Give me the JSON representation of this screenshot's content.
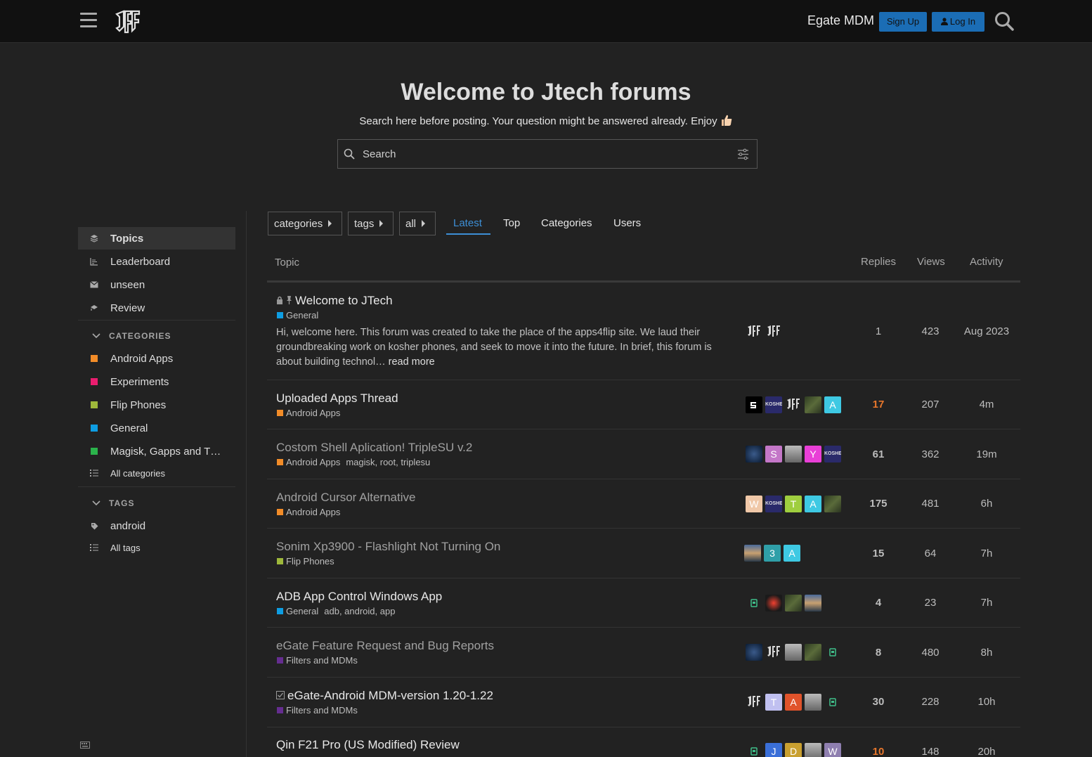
{
  "header": {
    "site_name": "Egate MDM",
    "signup_label": "Sign Up",
    "login_label": "Log In"
  },
  "banner": {
    "title": "Welcome to Jtech forums",
    "subtitle": "Search here before posting. Your question might be answered already. Enjoy",
    "search_placeholder": "Search"
  },
  "sidebar": {
    "items": [
      {
        "label": "Topics",
        "icon": "layers-icon"
      },
      {
        "label": "Leaderboard",
        "icon": "chart-icon"
      },
      {
        "label": "unseen",
        "icon": "envelope-icon"
      },
      {
        "label": "Review",
        "icon": "review-icon"
      }
    ],
    "categories_heading": "CATEGORIES",
    "categories": [
      {
        "label": "Android Apps",
        "color": "#f28c28"
      },
      {
        "label": "Experiments",
        "color": "#ea1d6f"
      },
      {
        "label": "Flip Phones",
        "color": "#9eb83b"
      },
      {
        "label": "General",
        "color": "#0e9de2"
      },
      {
        "label": "Magisk, Gapps and T…",
        "color": "#2bb34b"
      }
    ],
    "all_categories": "All categories",
    "tags_heading": "TAGS",
    "tags": [
      {
        "label": "android"
      }
    ],
    "all_tags": "All tags"
  },
  "nav": {
    "dropdowns": [
      "categories",
      "tags",
      "all"
    ],
    "tabs": [
      "Latest",
      "Top",
      "Categories",
      "Users"
    ]
  },
  "table": {
    "headers": {
      "topic": "Topic",
      "replies": "Replies",
      "views": "Views",
      "activity": "Activity"
    },
    "rows": [
      {
        "title": "Welcome to JTech",
        "category": "General",
        "cat_color": "#0e9de2",
        "tags": "",
        "excerpt": "Hi, welcome here. This forum was created to take the place of the apps4flip site. We laud their groundbreaking work on kosher phones, and seek to move it into the future. In brief, this forum is about building technol…",
        "read_more": "read more",
        "replies": "1",
        "views": "423",
        "activity": "Aug 2023"
      },
      {
        "title": "Uploaded Apps Thread",
        "category": "Android Apps",
        "cat_color": "#f28c28",
        "tags": "",
        "replies": "17",
        "views": "207",
        "activity": "4m"
      },
      {
        "title": "Costom Shell Aplication! TripleSU v.2",
        "category": "Android Apps",
        "cat_color": "#f28c28",
        "tags": "magisk, root, triplesu",
        "replies": "61",
        "views": "362",
        "activity": "19m"
      },
      {
        "title": "Android Cursor Alternative",
        "category": "Android Apps",
        "cat_color": "#f28c28",
        "tags": "",
        "replies": "175",
        "views": "481",
        "activity": "6h"
      },
      {
        "title": "Sonim Xp3900 - Flashlight Not Turning On",
        "category": "Flip Phones",
        "cat_color": "#9eb83b",
        "tags": "",
        "replies": "15",
        "views": "64",
        "activity": "7h"
      },
      {
        "title": "ADB App Control Windows App",
        "category": "General",
        "cat_color": "#0e9de2",
        "tags": "adb, android, app",
        "replies": "4",
        "views": "23",
        "activity": "7h"
      },
      {
        "title": "eGate Feature Request and Bug Reports",
        "category": "Filters and MDMs",
        "cat_color": "#652d90",
        "tags": "",
        "replies": "8",
        "views": "480",
        "activity": "8h"
      },
      {
        "title": "eGate-Android MDM-version 1.20-1.22",
        "category": "Filters and MDMs",
        "cat_color": "#652d90",
        "tags": "",
        "replies": "30",
        "views": "228",
        "activity": "10h"
      },
      {
        "title": "Qin F21 Pro (US Modified) Review",
        "category": "",
        "cat_color": "#9eb83b",
        "tags": "",
        "replies": "10",
        "views": "148",
        "activity": "20h"
      }
    ]
  },
  "avatars": {
    "r1": [
      "JF",
      "JF"
    ],
    "r2": [
      "",
      "KOSHER",
      "JF",
      "",
      "A"
    ],
    "r3": [
      "",
      "S",
      "",
      "Y",
      "KOSHER"
    ],
    "r4": [
      "W",
      "KOSHER",
      "T",
      "A",
      ""
    ],
    "r5": [
      "",
      "3",
      "A"
    ],
    "r6": [
      "",
      "",
      "",
      ""
    ],
    "r7": [
      "",
      "JF",
      "",
      "",
      ""
    ],
    "r8": [
      "JF",
      "T",
      "A",
      "",
      ""
    ],
    "r9": [
      "",
      "J",
      "D",
      "",
      "W"
    ]
  }
}
